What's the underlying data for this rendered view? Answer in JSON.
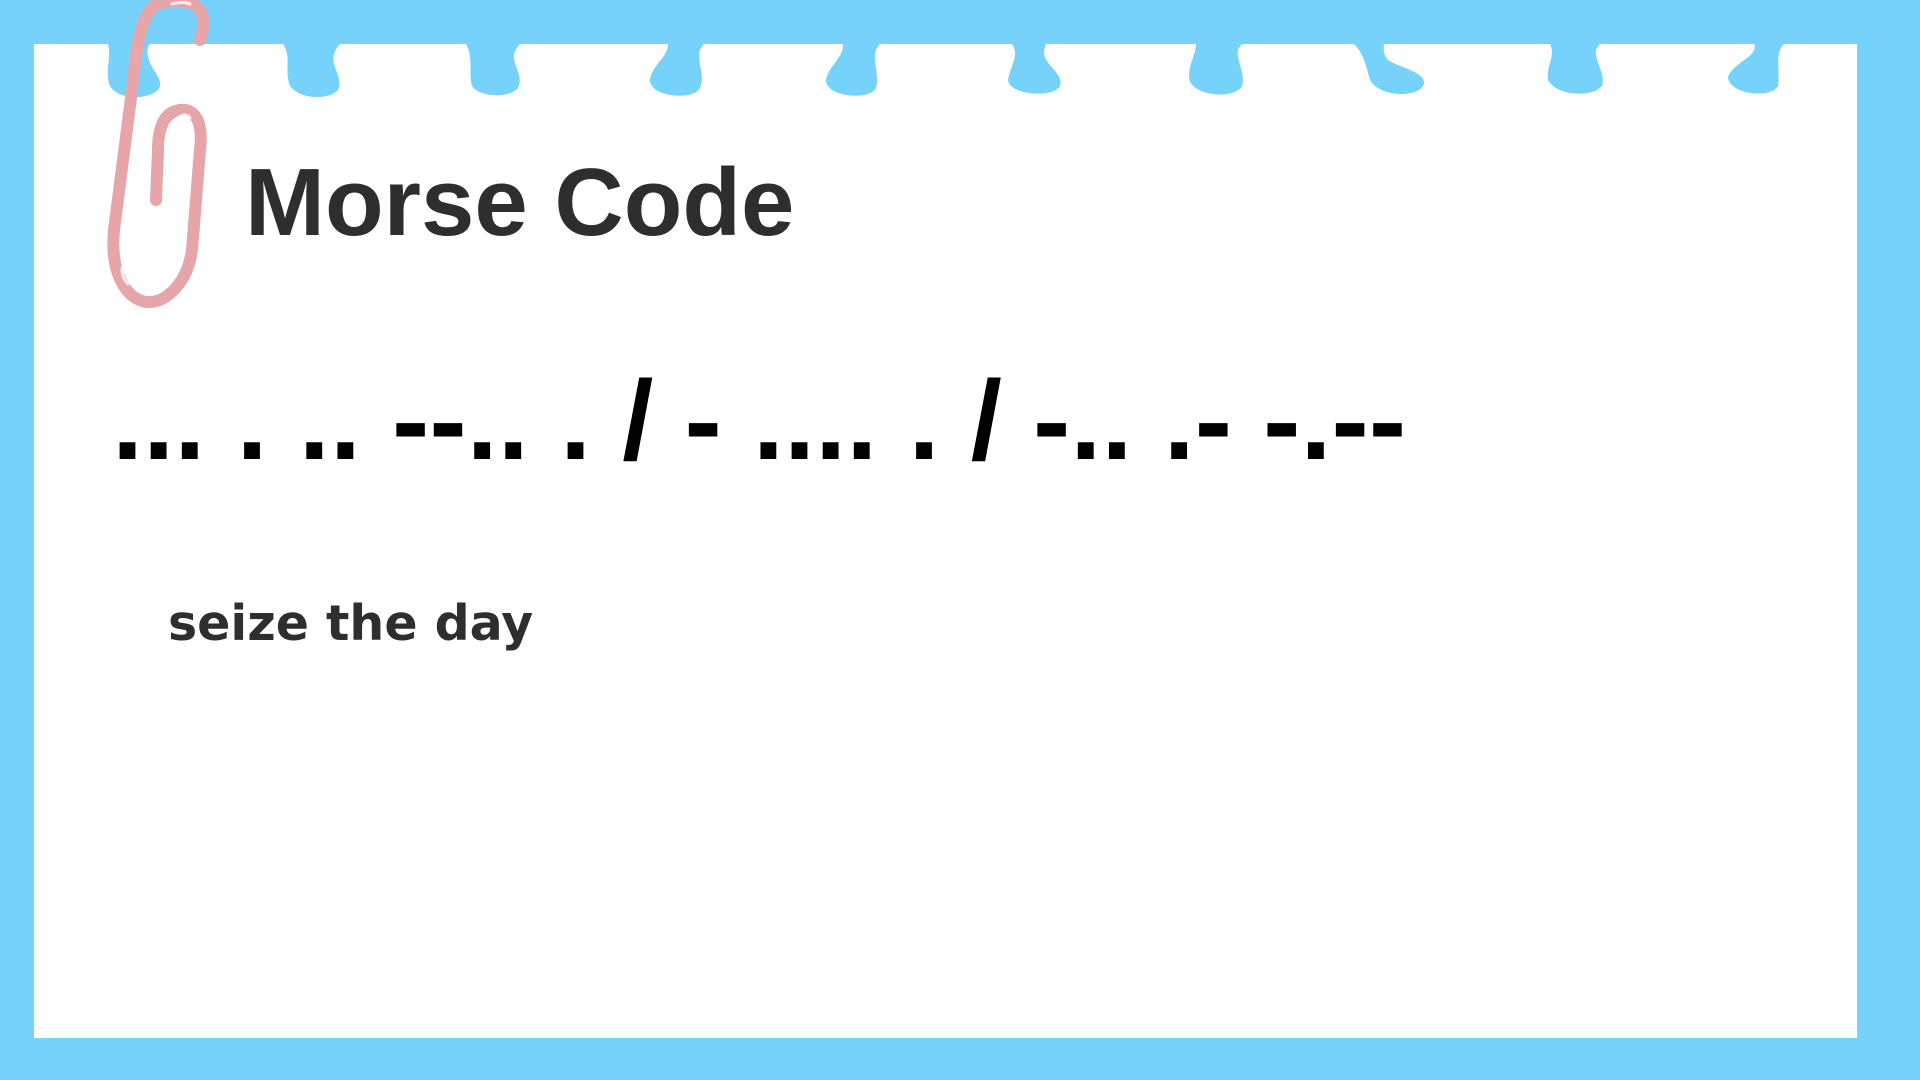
{
  "slide": {
    "title": "Morse Code",
    "morse_text": "... . .. --.. . / - .... . / -.. .- -.--",
    "translation": "seize the day"
  },
  "colors": {
    "frame": "#76d2fb",
    "paper": "#ffffff",
    "title_text": "#2e2e2e",
    "morse_text": "#000000",
    "paperclip": "#e6a5a8"
  },
  "icons": {
    "paperclip": "paperclip-icon"
  }
}
